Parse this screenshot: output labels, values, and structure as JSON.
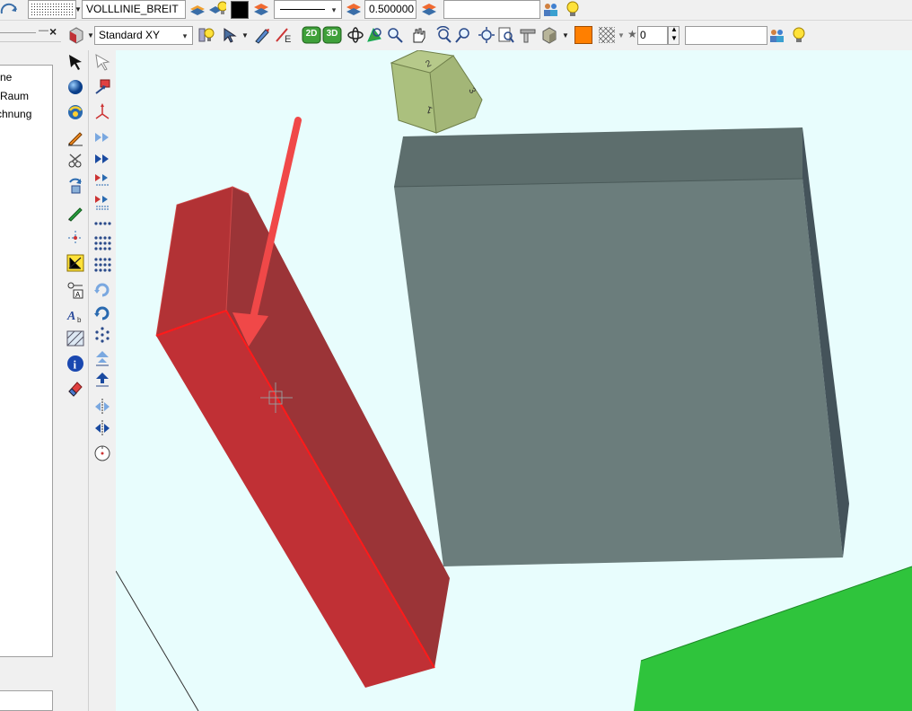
{
  "toolbar1": {
    "linetype_value": "VOLLLINIE_BREIT",
    "linewidth_value": "0.500000",
    "color_swatch": "#000000",
    "empty_field_value": ""
  },
  "toolbar2": {
    "view_select_value": "Standard XY",
    "btn_2d_label": "2D",
    "btn_3d_label": "3D",
    "fill_color": "#ff7f00",
    "number_value": "0",
    "search_value": ""
  },
  "tree": {
    "items": [
      "ne",
      "Raum",
      "chnung"
    ]
  },
  "panel_header": {
    "pin_glyph": "—",
    "close_glyph": "×"
  },
  "viewcube": {
    "face_top": "2",
    "face_front": "1",
    "face_right": "3"
  },
  "colors": {
    "viewport_bg": "#e8fdfd",
    "red_box_front": "#c03035",
    "red_box_side": "#9b3437",
    "gray_box_front": "#6b7d7c",
    "gray_box_top": "#5d6e6d",
    "gray_box_side": "#44535a",
    "green_box": "#2fc43c",
    "arrow": "#f04848"
  }
}
